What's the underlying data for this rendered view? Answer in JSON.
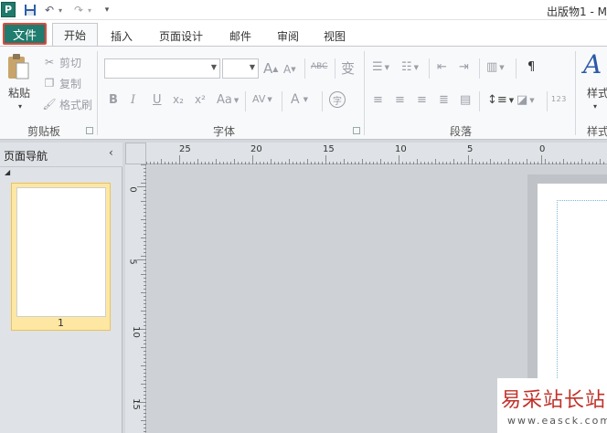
{
  "titlebar": {
    "app_icon": "P",
    "title": "出版物1 - M",
    "quick_access": [
      {
        "name": "save-icon",
        "glyph": "💾"
      },
      {
        "name": "undo-icon",
        "glyph": "↶"
      },
      {
        "name": "redo-icon",
        "glyph": "↷"
      }
    ]
  },
  "tabs": {
    "file": "文件",
    "home": "开始",
    "insert": "插入",
    "page_design": "页面设计",
    "mailings": "邮件",
    "review": "审阅",
    "view": "视图"
  },
  "ribbon": {
    "clipboard": {
      "label": "剪贴板",
      "paste": "粘贴",
      "cut": "剪切",
      "copy": "复制",
      "format_painter": "格式刷"
    },
    "font": {
      "label": "字体",
      "font_name": "",
      "font_size": "",
      "grow": "A",
      "shrink": "A",
      "clear": "ABC",
      "phonetic": "变",
      "bold": "B",
      "italic": "I",
      "underline": "U",
      "subscript": "x₂",
      "superscript": "x²",
      "change_case": "Aa",
      "char_spacing": "AV",
      "font_color": "A",
      "enclose": "字"
    },
    "paragraph": {
      "label": "段落",
      "spacing_num": "1 2 3"
    },
    "styles": {
      "label": "样式",
      "button": "样式"
    }
  },
  "nav_pane": {
    "title": "页面导航",
    "page_number": "1"
  },
  "ruler": {
    "horizontal": [
      "25",
      "20",
      "15",
      "10",
      "5",
      "0"
    ],
    "vertical": [
      "0",
      "5",
      "10",
      "15"
    ]
  },
  "watermark": {
    "line1": "易采站长站",
    "line2": "www.easck.com"
  },
  "colors": {
    "file_tab": "#1f7c6e",
    "highlight_border": "#e2483a",
    "ribbon_bg": "#f8f9fa",
    "page_thumb": "#fde7a3"
  }
}
